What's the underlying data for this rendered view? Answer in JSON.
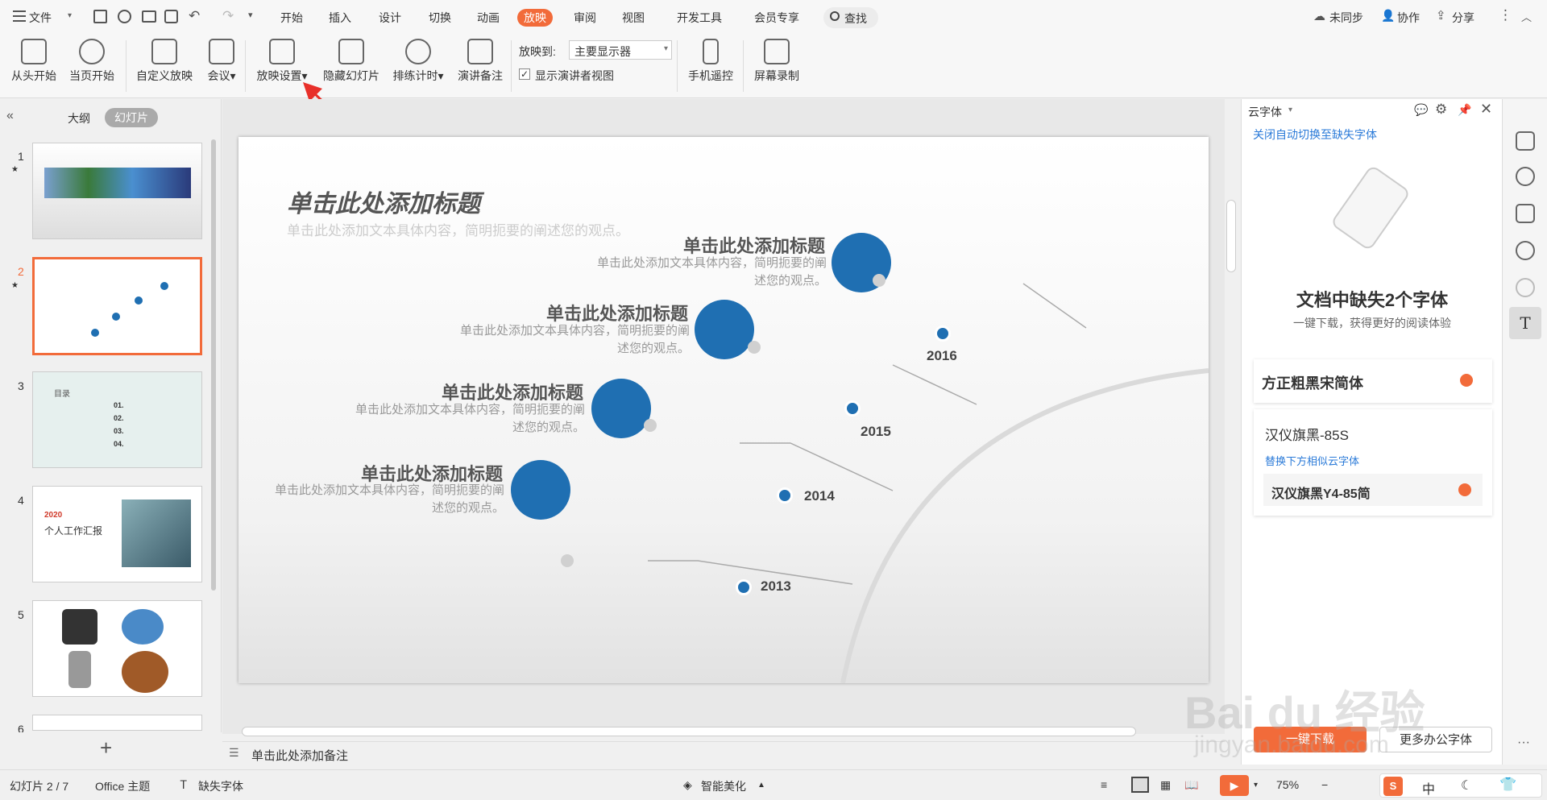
{
  "menubar": {
    "file": "文件",
    "tabs": [
      "开始",
      "插入",
      "设计",
      "切换",
      "动画",
      "放映",
      "审阅",
      "视图",
      "开发工具",
      "会员专享"
    ],
    "active_tab": "放映",
    "search": "查找",
    "sync": "未同步",
    "collab": "协作",
    "share": "分享"
  },
  "ribbon": {
    "from_start": "从头开始",
    "from_current": "当页开始",
    "custom_show": "自定义放映",
    "meeting": "会议",
    "show_settings": "放映设置",
    "hide_slide": "隐藏幻灯片",
    "rehearse": "排练计时",
    "speaker_notes": "演讲备注",
    "show_to_label": "放映到:",
    "show_to_value": "主要显示器",
    "presenter_view": "显示演讲者视图",
    "phone_remote": "手机遥控",
    "screen_record": "屏幕录制"
  },
  "left": {
    "outline": "大纲",
    "slides": "幻灯片",
    "numbers": [
      "1",
      "2",
      "3",
      "4",
      "5",
      "6"
    ],
    "thumb3": {
      "title": "目录",
      "items": [
        "01.",
        "02.",
        "03.",
        "04."
      ]
    },
    "thumb4": {
      "year": "2020",
      "title": "个人工作汇报"
    }
  },
  "slide": {
    "title": "单击此处添加标题",
    "subtitle": "单击此处添加文本具体内容，简明扼要的阐述您的观点。",
    "items": [
      {
        "title": "单击此处添加标题",
        "desc1": "单击此处添加文本具体内容，简明扼要的阐",
        "desc2": "述您的观点。",
        "year": "2016"
      },
      {
        "title": "单击此处添加标题",
        "desc1": "单击此处添加文本具体内容，简明扼要的阐",
        "desc2": "述您的观点。",
        "year": "2015"
      },
      {
        "title": "单击此处添加标题",
        "desc1": "单击此处添加文本具体内容，简明扼要的阐",
        "desc2": "述您的观点。",
        "year": "2014"
      },
      {
        "title": "单击此处添加标题",
        "desc1": "单击此处添加文本具体内容，简明扼要的阐",
        "desc2": "述您的观点。",
        "year": "2013"
      }
    ]
  },
  "notes": "单击此处添加备注",
  "rightpanel": {
    "title": "云字体",
    "link": "关闭自动切换至缺失字体",
    "heading": "文档中缺失2个字体",
    "subheading": "一键下载，获得更好的阅读体验",
    "font1": "方正粗黑宋简体",
    "font2": "汉仪旗黑-85S",
    "replace_hint": "替换下方相似云字体",
    "font2_alt": "汉仪旗黑Y4-85简",
    "download_btn": "一键下载",
    "more_btn": "更多办公字体"
  },
  "status": {
    "slide_count": "幻灯片 2 / 7",
    "theme": "Office 主题",
    "missing_font": "缺失字体",
    "beautify": "智能美化",
    "zoom": "75%",
    "ime": "中"
  },
  "watermark": {
    "text": "Bai du 经验",
    "url": "jingyan.baidu.com"
  },
  "colors": {
    "accent": "#f26b3a",
    "slide_blue": "#1f6fb2",
    "link": "#2a7ad8"
  }
}
